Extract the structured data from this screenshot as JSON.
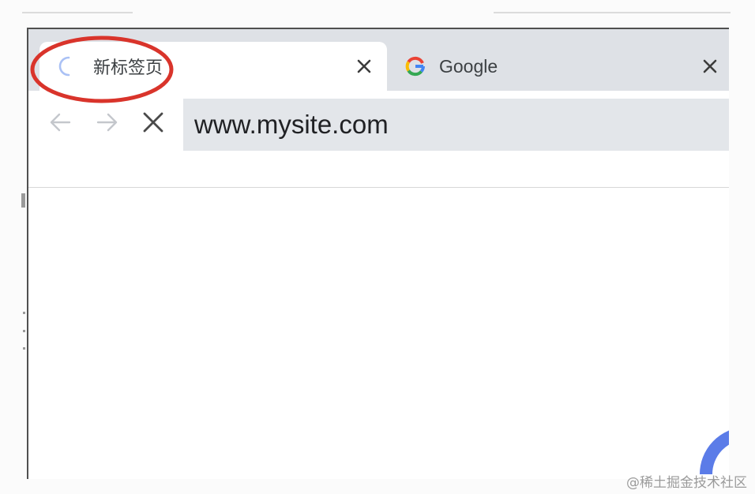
{
  "tabs": [
    {
      "title": "新标签页",
      "icon": "loading-spinner-icon",
      "close_icon": "close-icon"
    },
    {
      "title": "Google",
      "icon": "google-g-icon",
      "close_icon": "close-icon"
    }
  ],
  "toolbar": {
    "back_icon": "arrow-left-icon",
    "forward_icon": "arrow-right-icon",
    "stop_icon": "stop-loading-x-icon",
    "url": "www.mysite.com"
  },
  "annotation": {
    "shape": "ellipse",
    "color": "#d9342b",
    "target": "active-tab"
  },
  "watermark": "@稀土掘金技术社区",
  "colors": {
    "tabstrip": "#dee1e6",
    "omnibox": "#e3e6ea",
    "spinner": "#aac1f5",
    "accent_blue": "#5b7ce8"
  }
}
